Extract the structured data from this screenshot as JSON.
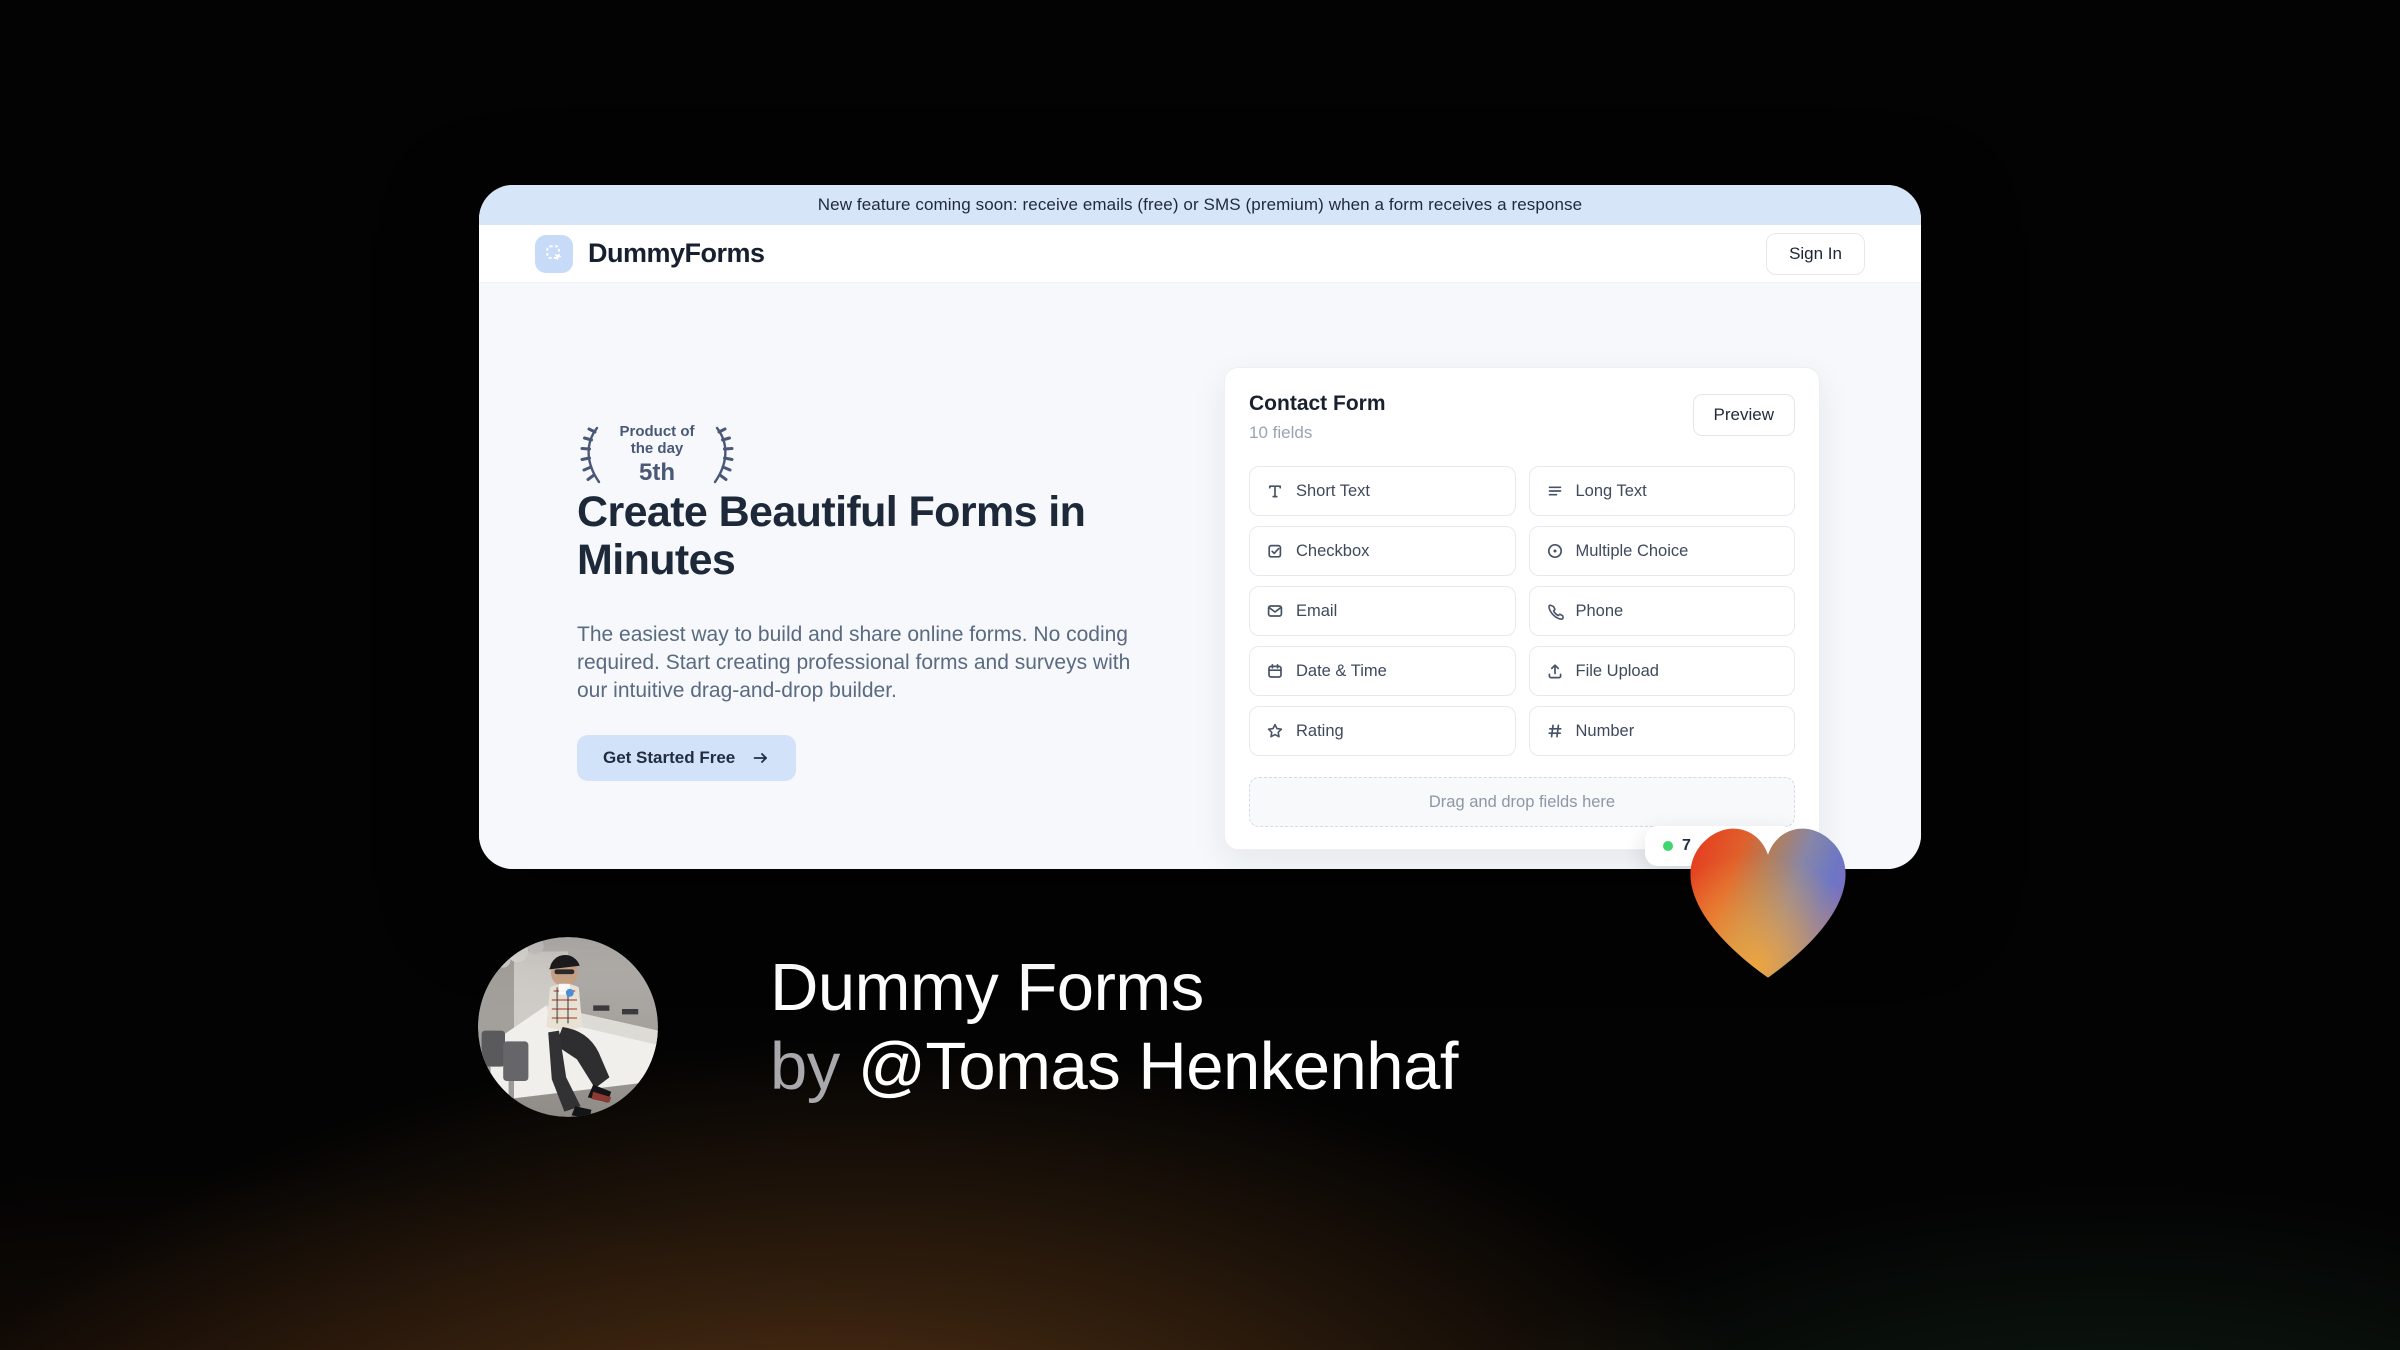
{
  "banner": {
    "text": "New feature coming soon: receive emails (free) or SMS (premium) when a form receives a response"
  },
  "nav": {
    "brand": "DummyForms",
    "sign_in_label": "Sign In"
  },
  "hero": {
    "award_top": "Product of the day",
    "award_rank": "5th",
    "title": "Create Beautiful Forms in Minutes",
    "description": "The easiest way to build and share online forms. No coding required. Start creating professional forms and surveys with our intuitive drag-and-drop builder.",
    "cta_label": "Get Started Free"
  },
  "form_card": {
    "title": "Contact Form",
    "subtitle": "10 fields",
    "preview_label": "Preview",
    "fields": [
      {
        "icon": "short-text-icon",
        "label": "Short Text"
      },
      {
        "icon": "long-text-icon",
        "label": "Long Text"
      },
      {
        "icon": "checkbox-icon",
        "label": "Checkbox"
      },
      {
        "icon": "multiple-choice-icon",
        "label": "Multiple Choice"
      },
      {
        "icon": "email-icon",
        "label": "Email"
      },
      {
        "icon": "phone-icon",
        "label": "Phone"
      },
      {
        "icon": "date-time-icon",
        "label": "Date & Time"
      },
      {
        "icon": "file-upload-icon",
        "label": "File Upload"
      },
      {
        "icon": "rating-icon",
        "label": "Rating"
      },
      {
        "icon": "number-icon",
        "label": "Number"
      }
    ],
    "dropzone_text": "Drag and drop fields here",
    "status_badge": {
      "text": "7"
    }
  },
  "footer": {
    "line1": "Dummy Forms",
    "by": "by",
    "author": "@Tomas Henkenhaf"
  },
  "colors": {
    "banner_bg": "#d7e5f9",
    "accent_light_blue": "#d2e2f9",
    "logo_bg": "#c7dbf8",
    "page_bg": "#f6f8fb",
    "headline": "#1d2839",
    "body_text": "#5a6a80",
    "status_green": "#3fd56f",
    "heart_red": "#e63a1f",
    "heart_orange": "#f2a63b",
    "heart_purple": "#6d77c5"
  }
}
